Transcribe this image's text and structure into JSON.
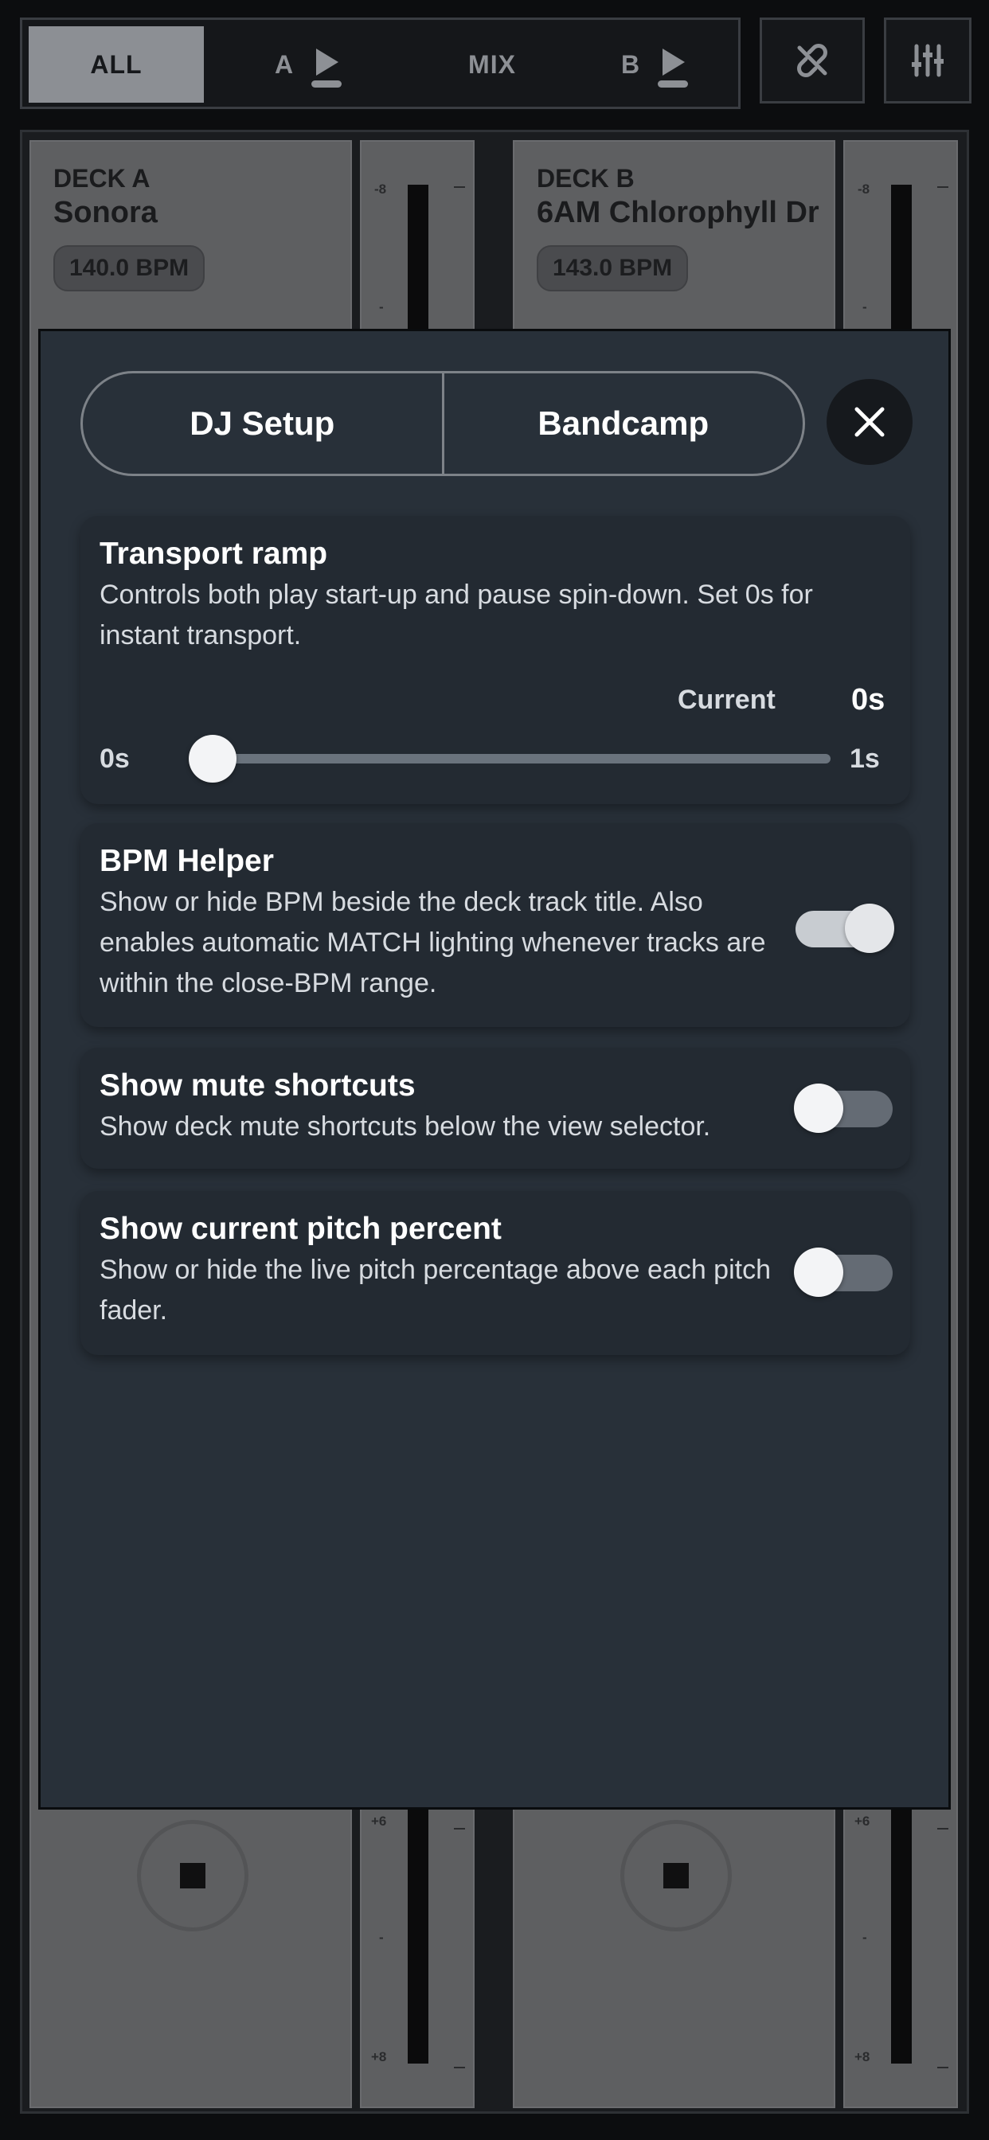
{
  "topbar": {
    "view_tabs": [
      "ALL",
      "A",
      "MIX",
      "B"
    ],
    "active_tab": "ALL"
  },
  "icons": {
    "link": "unlink-icon",
    "mixer": "sliders-icon",
    "close": "close-icon",
    "play": "play-icon"
  },
  "decks": {
    "a": {
      "label": "DECK A",
      "title": "Sonora",
      "bpm": "140.0 BPM"
    },
    "b": {
      "label": "DECK B",
      "title": "6AM Chlorophyll Dr",
      "bpm": "143.0 BPM"
    }
  },
  "pitch_fader": {
    "top_tick": "-8",
    "mid_tick": "-",
    "lower_top_tick": "+6",
    "bottom_tick": "+8"
  },
  "settings": {
    "tabs": [
      "DJ Setup",
      "Bandcamp"
    ],
    "transport_ramp": {
      "title": "Transport ramp",
      "description": "Controls both play start-up and pause spin-down. Set 0s for instant transport.",
      "current_label": "Current",
      "current_value": "0s",
      "min_label": "0s",
      "max_label": "1s",
      "value_fraction": 0
    },
    "bpm_helper": {
      "title": "BPM Helper",
      "description": "Show or hide BPM beside the deck track title. Also enables automatic MATCH lighting whenever tracks are within the close-BPM range.",
      "enabled": true
    },
    "mute_shortcuts": {
      "title": "Show mute shortcuts",
      "description": "Show deck mute shortcuts below the view selector.",
      "enabled": false
    },
    "pitch_percent": {
      "title": "Show current pitch percent",
      "description": "Show or hide the live pitch percentage above each pitch fader.",
      "enabled": false
    }
  },
  "colors": {
    "modal_bg": "#283039",
    "card_bg": "#232a32",
    "toggle_on": "#c8ccd1",
    "toggle_off": "#646b74"
  }
}
